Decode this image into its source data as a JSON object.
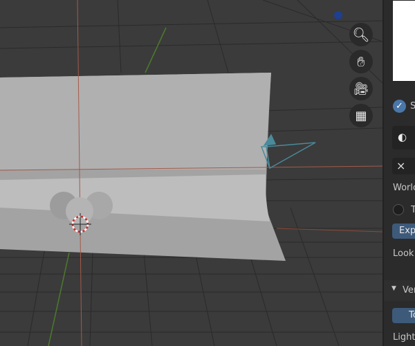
{
  "viewport": {
    "nav_tools": [
      {
        "icon": "zoom-icon"
      },
      {
        "icon": "pan-hand-icon"
      },
      {
        "icon": "camera-view-icon"
      },
      {
        "icon": "perspective-grid-icon"
      }
    ]
  },
  "properties_panel": {
    "checkbox_label": "S",
    "checkbox_checked": true,
    "close_label": "×",
    "world_label": "Worlo",
    "radio_label": "T",
    "export_button": "Expo",
    "look_label": "Look:",
    "section_label": "Ver",
    "section_arrow": "▼",
    "to_button": "To",
    "lights_label": "Lights"
  },
  "colors": {
    "accent": "#3d5a7a",
    "panel_bg": "#2b2b2b",
    "viewport_bg": "#3b3b3b"
  }
}
